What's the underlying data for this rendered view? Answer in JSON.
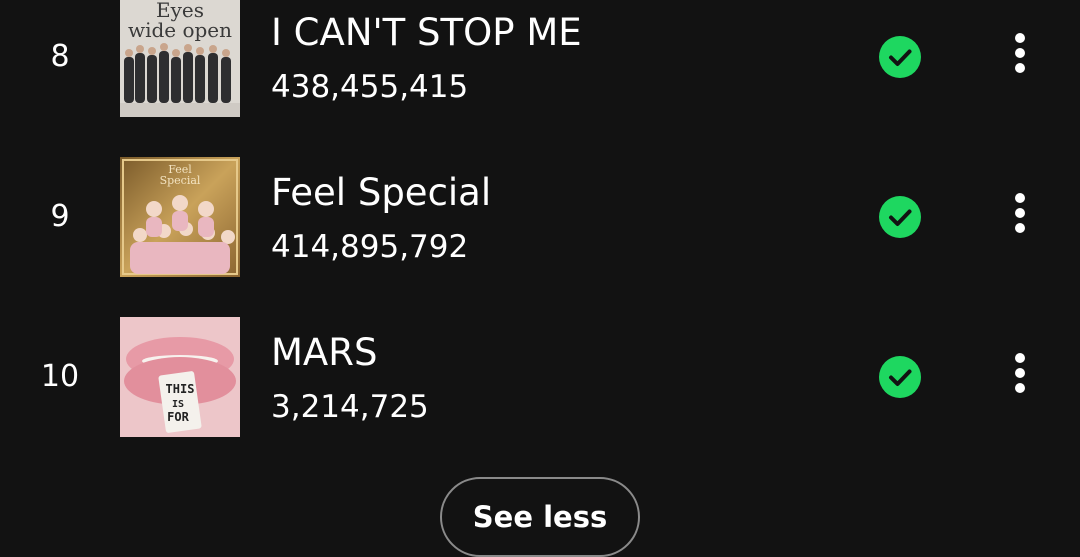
{
  "tracks": [
    {
      "rank": "8",
      "title": "I CAN'T STOP ME",
      "plays": "438,455,415",
      "saved": true,
      "cover": {
        "art_text_1": "Eyes",
        "art_text_2": "wide open",
        "bg": "#dad6d0"
      }
    },
    {
      "rank": "9",
      "title": "Feel Special",
      "plays": "414,895,792",
      "saved": true,
      "cover": {
        "art_text_1": "Feel",
        "art_text_2": "Special",
        "bg": "#b08a4a"
      }
    },
    {
      "rank": "10",
      "title": "MARS",
      "plays": "3,214,725",
      "saved": true,
      "cover": {
        "art_text_1": "THIS",
        "art_text_2": "IS",
        "art_text_3": "FOR",
        "bg": "#e8b8bd"
      }
    }
  ],
  "see_less_label": "See less",
  "colors": {
    "background": "#121212",
    "text": "#ffffff",
    "saved_green": "#1ed760",
    "button_border": "#8a8a8a"
  },
  "icons": {
    "saved": "check-circle-icon",
    "more": "vertical-ellipsis-icon"
  }
}
